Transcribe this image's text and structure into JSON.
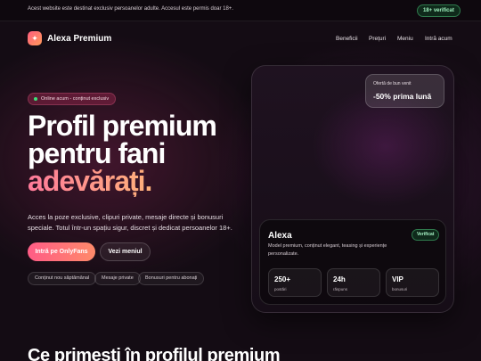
{
  "topbar": {
    "notice": "Acest website este destinat exclusiv persoanelor adulte. Accesul este permis doar 18+.",
    "age_badge": "18+ verificat"
  },
  "nav": {
    "logo_icon": "sparkle-icon",
    "logo_glyph": "✦",
    "brand": "Alexa Premium",
    "links": [
      "Beneficii",
      "Prețuri",
      "Meniu",
      "Intră acum"
    ]
  },
  "hero": {
    "status_pill": "Online acum - conținut exclusiv",
    "title_line1": "Profil premium",
    "title_line2": "pentru fani",
    "title_line3": "adevărați.",
    "description": "Acces la poze exclusive, clipuri private, mesaje directe și bonusuri speciale. Totul într-un spațiu sigur, discret și dedicat persoanelor 18+.",
    "primary_button": "Intră pe OnlyFans",
    "secondary_button": "Vezi meniul",
    "chips": [
      "Conținut nou săptămânal",
      "Mesaje private",
      "Bonusuri pentru abonați"
    ]
  },
  "card": {
    "offer_label": "Ofertă de bun venit",
    "offer_value": "-50% prima lună",
    "name": "Alexa",
    "verified": "Verificat",
    "description": "Model premium, conținut elegant, teasing și experiențe personalizate.",
    "stats": [
      {
        "value": "250+",
        "label": "postări"
      },
      {
        "value": "24h",
        "label": "răspuns"
      },
      {
        "value": "VIP",
        "label": "bonusuri"
      }
    ]
  },
  "next_section": {
    "title": "Ce primești în profilul premium"
  },
  "colors": {
    "accent_start": "#ff5c86",
    "accent_end": "#ff9a5a",
    "verified_green": "#9ff2bf",
    "background": "#140c14"
  }
}
